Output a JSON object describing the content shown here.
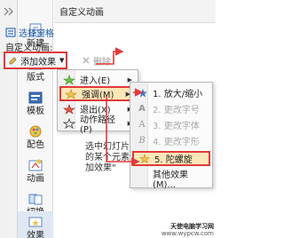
{
  "sidebar": {
    "items": [
      {
        "label": "新建",
        "icon": "new-slide-icon"
      },
      {
        "label": "版式",
        "icon": "layout-icon"
      },
      {
        "label": "模板",
        "icon": "template-icon"
      },
      {
        "label": "配色",
        "icon": "color-scheme-icon"
      },
      {
        "label": "动画",
        "icon": "animation-icon"
      },
      {
        "label": "切换",
        "icon": "transition-icon"
      },
      {
        "label": "效果",
        "icon": "effect-icon"
      }
    ]
  },
  "panel": {
    "title": "自定义动画",
    "select_pane": "选择窗格",
    "custom_label": "自定义动画:",
    "add_effect": "添加效果",
    "delete": "删除",
    "hint": "选中幻灯片的某个元素加效果\""
  },
  "menu1": {
    "items": [
      {
        "label": "进入(E)",
        "icon": "enter-effect-icon"
      },
      {
        "label": "强调(M)",
        "icon": "emphasis-effect-icon"
      },
      {
        "label": "退出(X)",
        "icon": "exit-effect-icon"
      },
      {
        "label": "动作路径(P)",
        "icon": "motion-path-icon"
      }
    ]
  },
  "menu2": {
    "items": [
      {
        "label": "1. 放大/缩小",
        "icon": "grow-shrink-icon",
        "disabled": false
      },
      {
        "label": "2. 更改字号",
        "icon": "font-size-icon",
        "disabled": true
      },
      {
        "label": "3. 更改字体",
        "icon": "font-change-icon",
        "disabled": true
      },
      {
        "label": "4. 更改字形",
        "icon": "font-style-icon",
        "disabled": true
      },
      {
        "label": "5. 陀螺旋",
        "icon": "spin-icon",
        "disabled": false
      },
      {
        "label": "其他效果(M)...",
        "icon": "",
        "disabled": false
      }
    ]
  },
  "watermark": {
    "line1": "天使电脑学习网",
    "line2": "www.wypcw.com"
  },
  "colors": {
    "highlight_border": "#e03a3a",
    "highlight_fill": "#fbe6b8",
    "link": "#1f58a8"
  }
}
